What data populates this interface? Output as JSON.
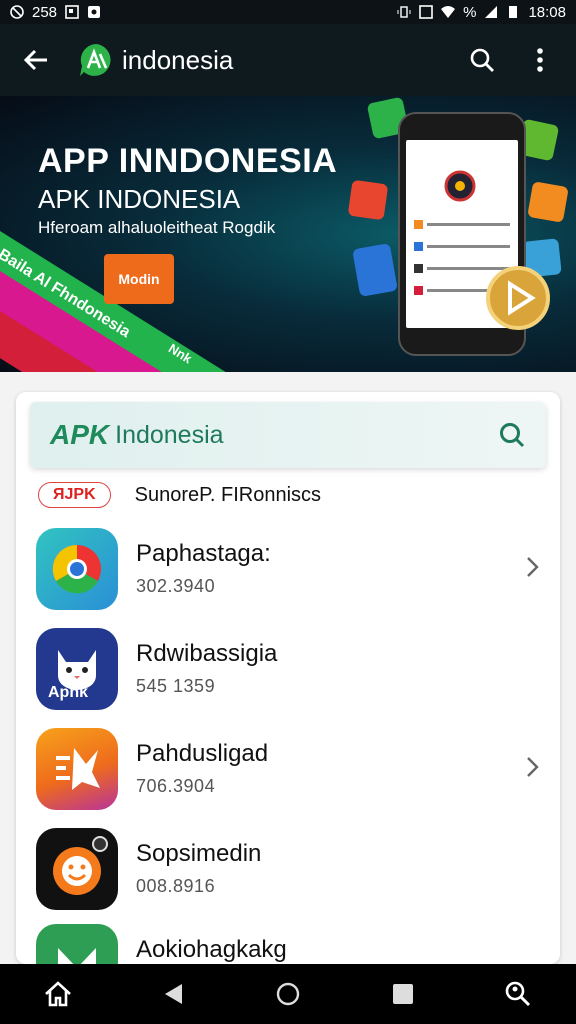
{
  "status_bar": {
    "left_text": "258",
    "time": "18:08",
    "battery": "%"
  },
  "app_bar": {
    "title": "indonesia"
  },
  "banner": {
    "title": "APP INNDONESIA",
    "subtitle": "APK INDONESIA",
    "tagline": "Hferoam alhaluoleitheat Rogdik",
    "stripe_text": "Baila Al Fhndonesia",
    "card_text": "Modin",
    "stripe_text_2": "Nnk"
  },
  "search": {
    "logo_text": "APK",
    "text": "Indonesia"
  },
  "category": {
    "badge": "ЯJPK",
    "label": "SunoreP. FIRonniscs"
  },
  "apps": [
    {
      "name": "Paphastaga:",
      "number": "302.3940",
      "has_chevron": true,
      "icon": "chrome-icon"
    },
    {
      "name": "Rdwibassigia",
      "number": "545 1359",
      "has_chevron": false,
      "icon": "cat-apk-icon"
    },
    {
      "name": "Pahdusligad",
      "number": "706.3904",
      "has_chevron": true,
      "icon": "star-app-icon"
    },
    {
      "name": "Sopsimedin",
      "number": "008.8916",
      "has_chevron": false,
      "icon": "smile-app-icon"
    },
    {
      "name": "Aokiohagkakg",
      "number": "",
      "has_chevron": false,
      "icon": "green-app-icon"
    }
  ],
  "icon_badge_text": "Apnk",
  "colors": {
    "accent": "#1f8a5b",
    "stripe_green": "#23b34d",
    "stripe_pink": "#d8188e",
    "stripe_red": "#d31f3a"
  }
}
